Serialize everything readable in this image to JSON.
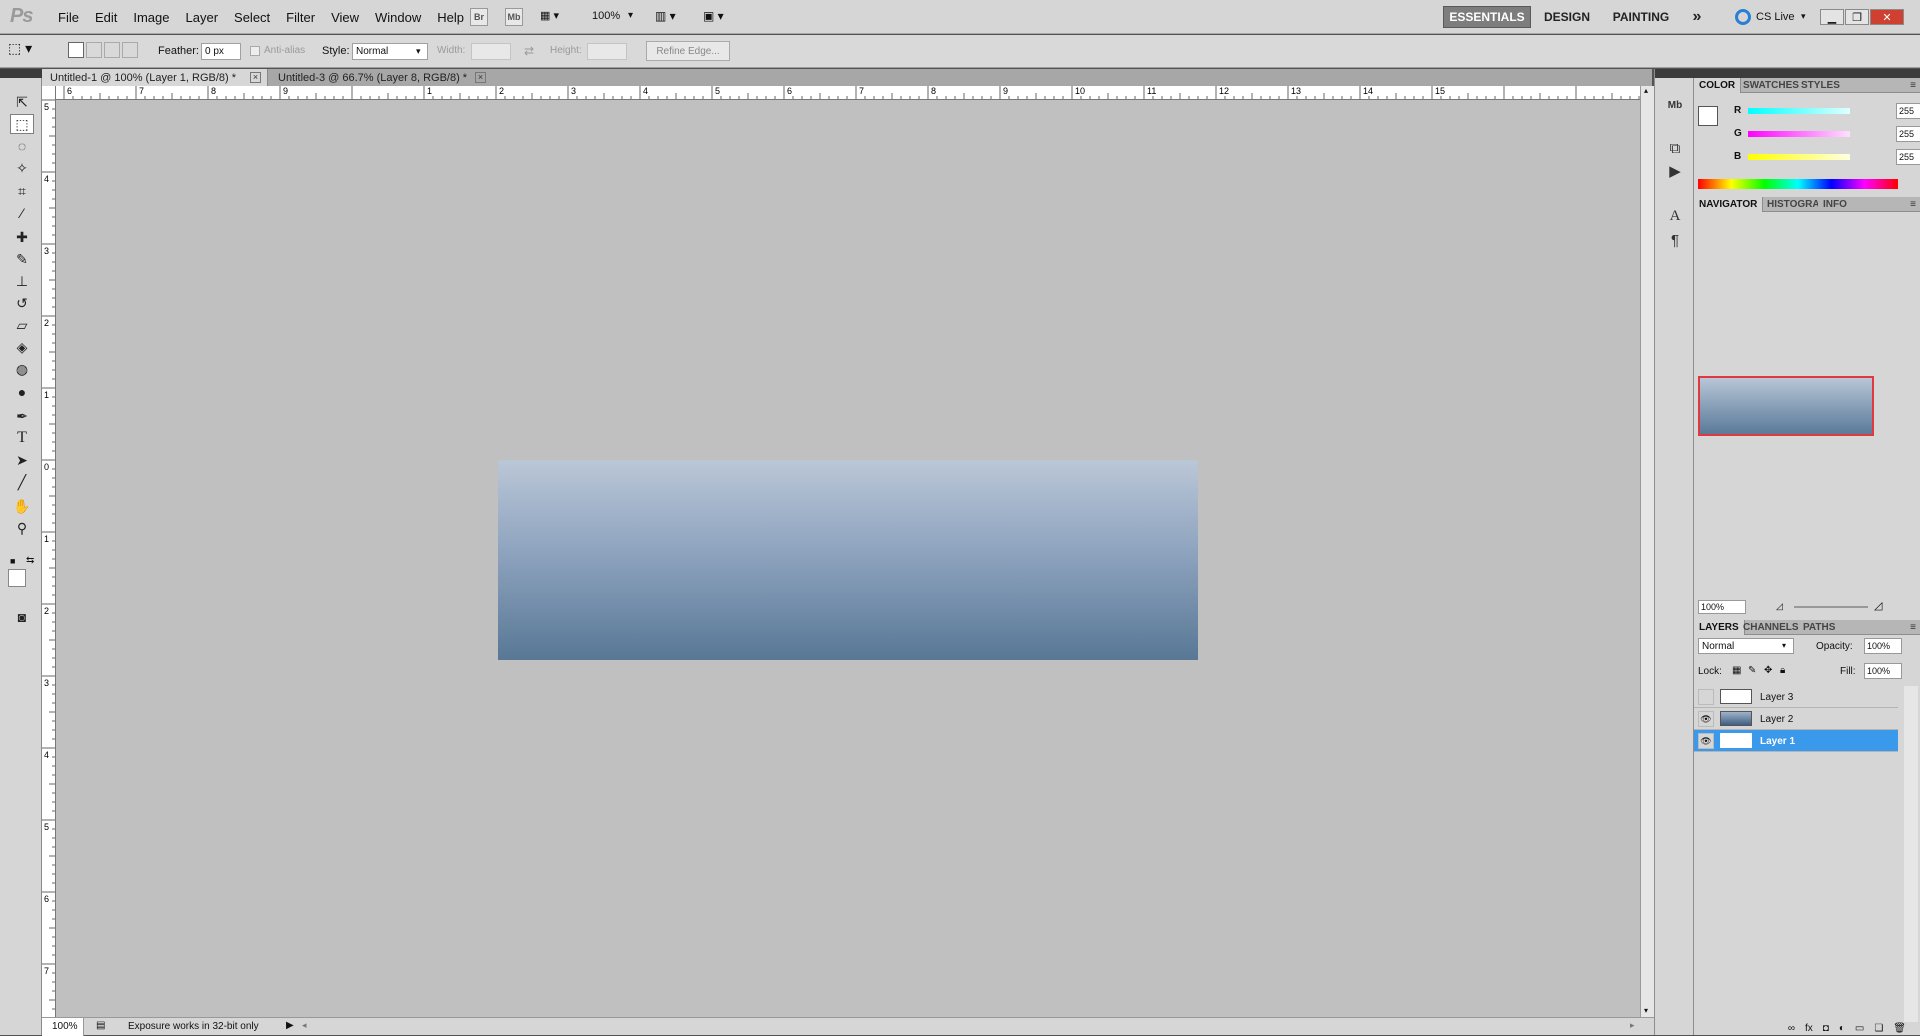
{
  "app": {
    "logo": "Ps"
  },
  "menu": [
    "File",
    "Edit",
    "Image",
    "Layer",
    "Select",
    "Filter",
    "View",
    "Window",
    "Help"
  ],
  "appbar": {
    "bridge": "Br",
    "minibridge": "Mb",
    "zoom": "100%",
    "workspaces": [
      "ESSENTIALS",
      "DESIGN",
      "PAINTING"
    ],
    "more": "»",
    "cslive": "CS Live"
  },
  "options": {
    "feather_label": "Feather:",
    "feather_value": "0 px",
    "antialias_label": "Anti-alias",
    "style_label": "Style:",
    "style_value": "Normal",
    "width_label": "Width:",
    "height_label": "Height:",
    "refine_label": "Refine Edge..."
  },
  "tabs": [
    {
      "label": "Untitled-1 @ 100% (Layer 1, RGB/8) *",
      "active": true
    },
    {
      "label": "Untitled-3 @ 66.7% (Layer 8, RGB/8) *",
      "active": false
    }
  ],
  "rulers": {
    "h": [
      "6",
      "7",
      "8",
      "9",
      "1",
      "2",
      "3",
      "4",
      "5",
      "6",
      "7",
      "8",
      "9",
      "10",
      "11",
      "12",
      "13",
      "14",
      "15"
    ],
    "v": [
      "5",
      "4",
      "3",
      "2",
      "1",
      "0",
      "1",
      "2",
      "3",
      "4",
      "5",
      "6",
      "7"
    ]
  },
  "status": {
    "zoom": "100%",
    "message": "Exposure works in 32-bit only"
  },
  "color_panel": {
    "tabs": [
      "COLOR",
      "SWATCHES",
      "STYLES"
    ],
    "channels": [
      {
        "name": "R",
        "value": "255",
        "color": "#00e5e5"
      },
      {
        "name": "G",
        "value": "255",
        "color": "#e500e5"
      },
      {
        "name": "B",
        "value": "255",
        "color": "#e5e500"
      }
    ],
    "foreground": "#ffffff",
    "background": "#1c4a86"
  },
  "navigator_panel": {
    "tabs": [
      "NAVIGATOR",
      "HISTOGRAM",
      "INFO"
    ],
    "zoom": "100%"
  },
  "layers_panel": {
    "tabs": [
      "LAYERS",
      "CHANNELS",
      "PATHS"
    ],
    "blend_mode": "Normal",
    "opacity_label": "Opacity:",
    "opacity_value": "100%",
    "lock_label": "Lock:",
    "fill_label": "Fill:",
    "fill_value": "100%",
    "layers": [
      {
        "name": "Layer 3",
        "visible": false,
        "selected": false
      },
      {
        "name": "Layer 2",
        "visible": true,
        "selected": false
      },
      {
        "name": "Layer 1",
        "visible": true,
        "selected": true
      }
    ]
  }
}
